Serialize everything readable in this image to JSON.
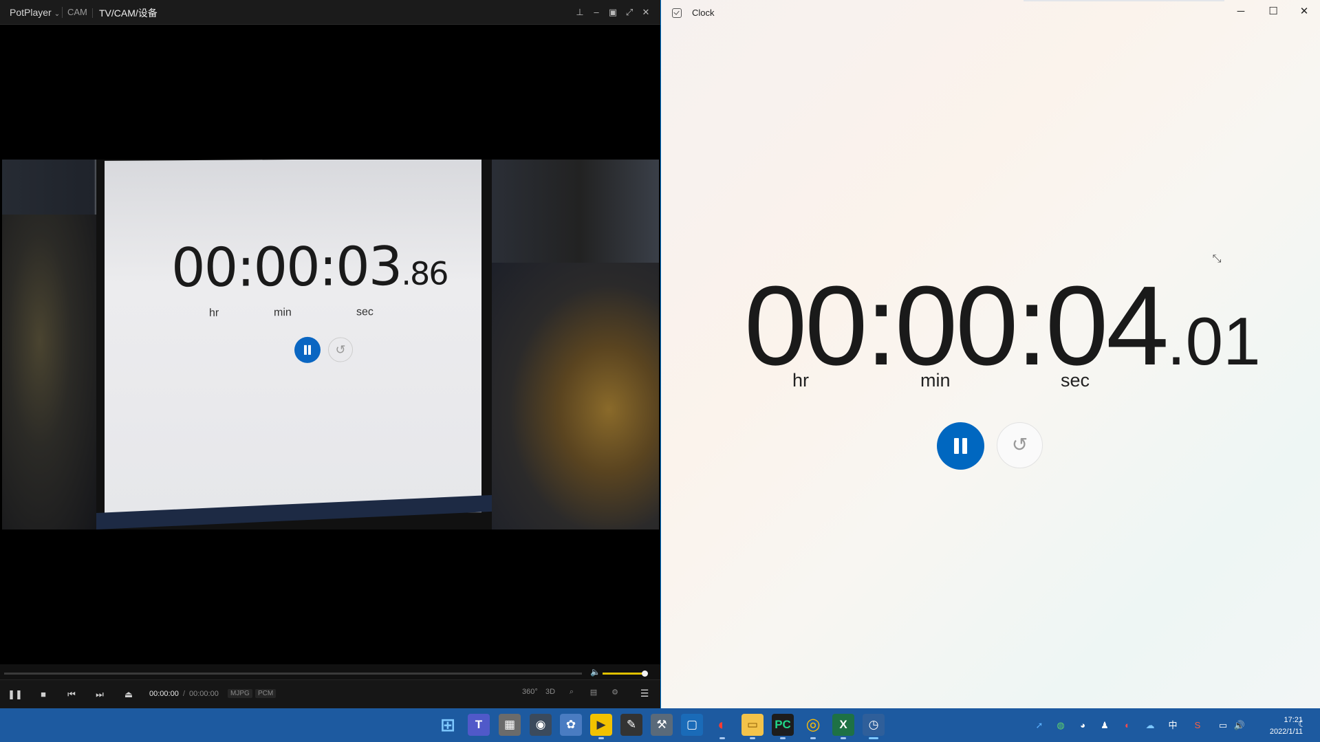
{
  "potplayer": {
    "menu_label": "PotPlayer",
    "breadcrumb": [
      "CAM",
      "TV/CAM/设备"
    ],
    "title_controls": [
      "pin-icon",
      "minimize-icon",
      "maximize-icon",
      "fullscreen-icon",
      "close-icon"
    ],
    "video_stopwatch": {
      "main": "00:00:03",
      "fraction": ".86",
      "units": [
        "hr",
        "min",
        "sec"
      ]
    },
    "time_current": "00:00:00",
    "time_separator": "/",
    "time_total": "00:00:00",
    "codec_tags": [
      "MJPG",
      "PCM"
    ],
    "right_toolbar": [
      "360°",
      "3D"
    ],
    "volume_level": 0.85,
    "accent": "#e0c000"
  },
  "clock": {
    "title": "Clock",
    "time_main": "00:00:04",
    "time_fraction": ".01",
    "units": {
      "hr": "hr",
      "min": "min",
      "sec": "sec"
    },
    "accent": "#0067c0"
  },
  "taskbar": {
    "tray_ime": "中",
    "time": "17:21",
    "date": "2022/1/11",
    "bg": "#1d5aa0"
  }
}
